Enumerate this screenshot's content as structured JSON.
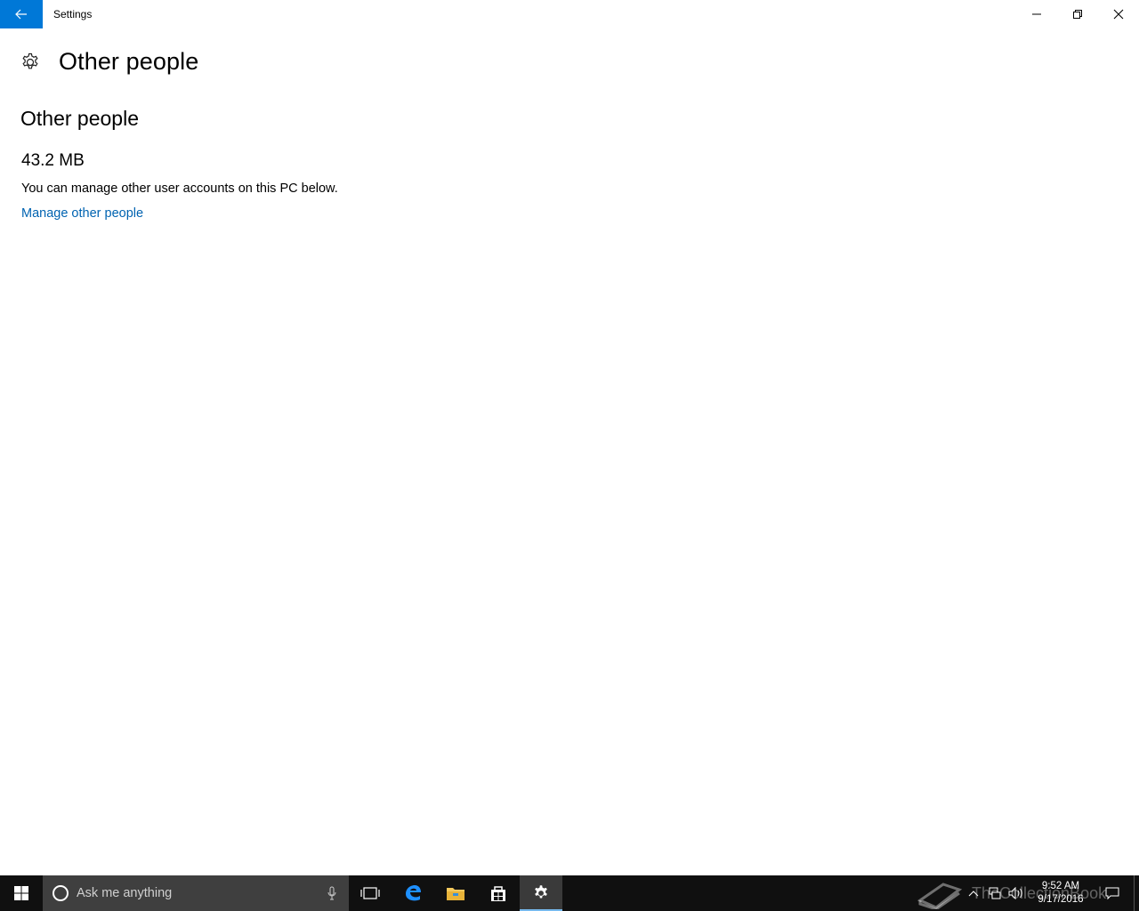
{
  "window": {
    "title": "Settings"
  },
  "page": {
    "title": "Other people",
    "section_title": "Other people",
    "size_value": "43.2 MB",
    "description": "You can manage other user accounts on this PC below.",
    "link_label": "Manage other people"
  },
  "taskbar": {
    "search_placeholder": "Ask me anything",
    "clock_time": "9:52 AM",
    "clock_date": "9/17/2016",
    "watermark_text": "TheCollectionBook"
  },
  "colors": {
    "accent": "#0078d7",
    "link": "#0063b1",
    "taskbar": "#101010"
  }
}
